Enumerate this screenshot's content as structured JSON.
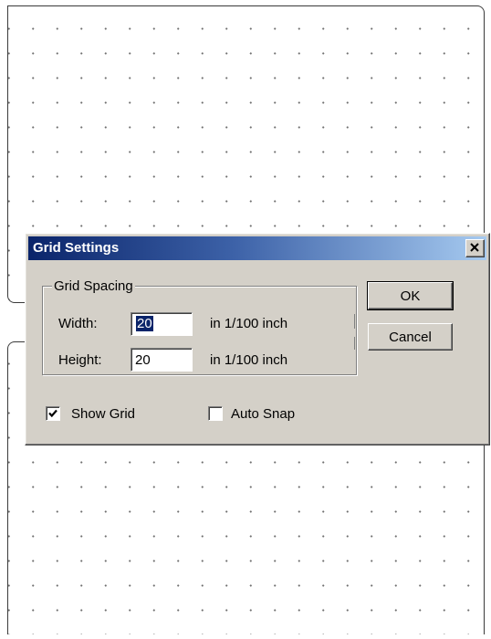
{
  "dialog": {
    "title": "Grid Settings",
    "close_glyph": "×",
    "group_label": "Grid Spacing",
    "width": {
      "label": "Width:",
      "value": "20",
      "unit": "in 1/100 inch",
      "selected": true
    },
    "height": {
      "label": "Height:",
      "value": "20",
      "unit": "in 1/100 inch"
    },
    "ok_label": "OK",
    "cancel_label": "Cancel",
    "show_grid": {
      "label": "Show Grid",
      "checked": true
    },
    "auto_snap": {
      "label": "Auto Snap",
      "checked": false
    }
  },
  "icons": {
    "close": "close-icon",
    "check": "checkmark-icon"
  },
  "colors": {
    "title_gradient_start": "#0a246a",
    "title_gradient_end": "#a6caf0",
    "dialog_face": "#d4d0c8",
    "selection": "#0a246a"
  }
}
